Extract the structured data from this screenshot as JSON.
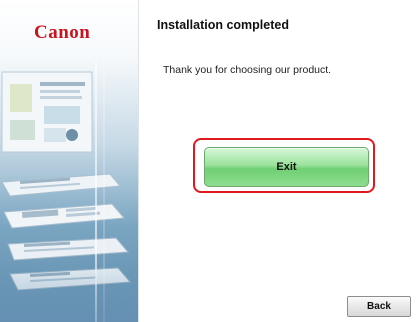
{
  "brand": {
    "logo_text": "Canon",
    "color": "#c8141e"
  },
  "main": {
    "heading": "Installation completed",
    "message": "Thank you for choosing our product.",
    "exit_label": "Exit",
    "back_label": "Back"
  },
  "colors": {
    "exit_button": "#8fdd91",
    "highlight_border": "#e0191e",
    "sidebar_accent": "#5c8aac"
  }
}
